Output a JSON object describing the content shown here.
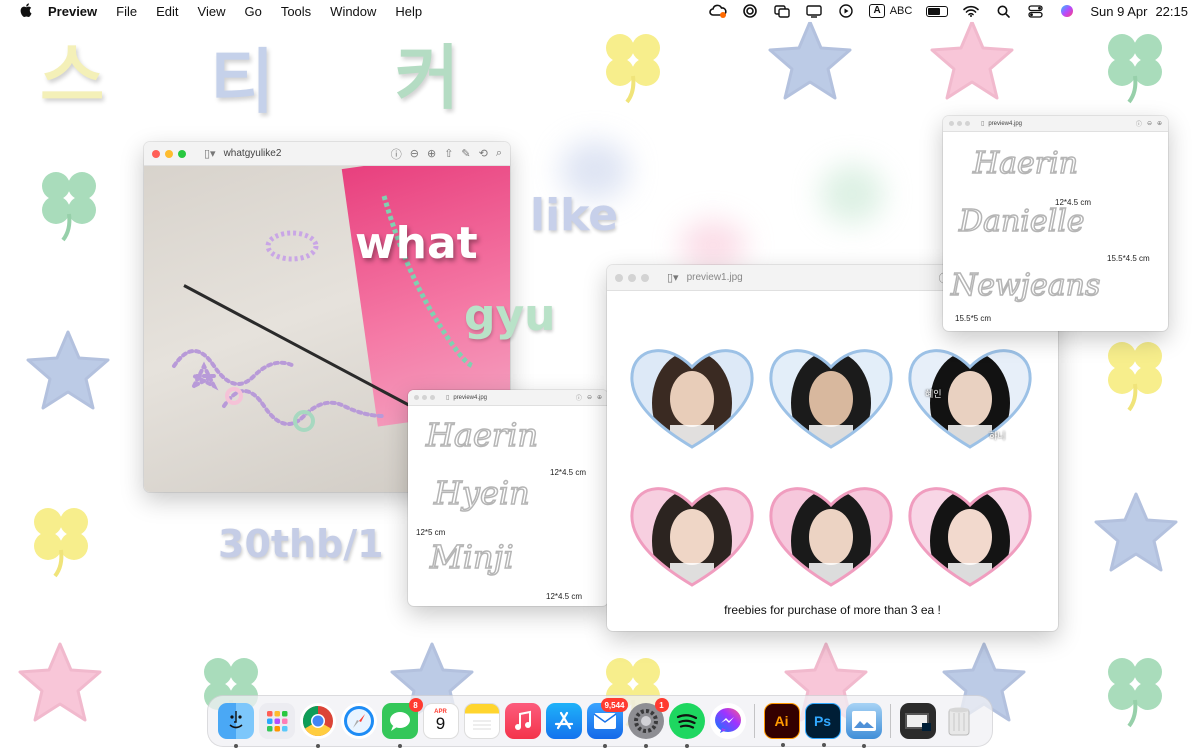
{
  "menubar": {
    "app_name": "Preview",
    "menus": [
      "File",
      "Edit",
      "View",
      "Go",
      "Tools",
      "Window",
      "Help"
    ],
    "input_source": "ABC",
    "date": "Sun 9 Apr",
    "time": "22:15",
    "battery_level": 0.7
  },
  "desktop": {
    "hangul_title": [
      "스",
      "티",
      "커"
    ],
    "word_what": "what",
    "word_like": "like",
    "word_gyu": "gyu",
    "price": "30thb/1",
    "colors": {
      "yellow": "#f7ee8c",
      "green": "#a9dcbb",
      "blue": "#bccbe6",
      "pink": "#f8c6d8"
    }
  },
  "window_main": {
    "title": "whatgyulike2",
    "photo_sticker_text": "Haerin"
  },
  "window_preview_small": {
    "title": "preview4.jpg",
    "names": [
      "Haerin",
      "Hyein",
      "Minji"
    ],
    "sizes": [
      "12*4.5 cm",
      "12*5 cm",
      "12*4.5 cm"
    ]
  },
  "window_preview1": {
    "title": "preview1.jpg",
    "heart_photo_labels": [
      "혜인",
      "하니"
    ],
    "caption": "freebies for purchase of more than 3 ea !"
  },
  "window_preview_top": {
    "title": "preview4.jpg",
    "names": [
      "Haerin",
      "Danielle",
      "Newjeans"
    ],
    "sizes": [
      "12*4.5 cm",
      "15.5*4.5 cm",
      "15.5*5 cm"
    ]
  },
  "dock": {
    "items": [
      {
        "name": "Finder"
      },
      {
        "name": "Launchpad"
      },
      {
        "name": "Chrome"
      },
      {
        "name": "Safari"
      },
      {
        "name": "Messages",
        "badge": "8"
      },
      {
        "name": "Calendar",
        "month": "APR",
        "day": "9"
      },
      {
        "name": "Notes"
      },
      {
        "name": "Music"
      },
      {
        "name": "App Store"
      },
      {
        "name": "Mail",
        "badge": "9,544"
      },
      {
        "name": "System Settings",
        "badge": "1"
      },
      {
        "name": "Spotify"
      },
      {
        "name": "Messenger"
      },
      {
        "name": "Illustrator",
        "label": "Ai"
      },
      {
        "name": "Photoshop",
        "label": "Ps"
      },
      {
        "name": "Preview"
      },
      {
        "name": "Downloads"
      },
      {
        "name": "Trash"
      }
    ]
  }
}
